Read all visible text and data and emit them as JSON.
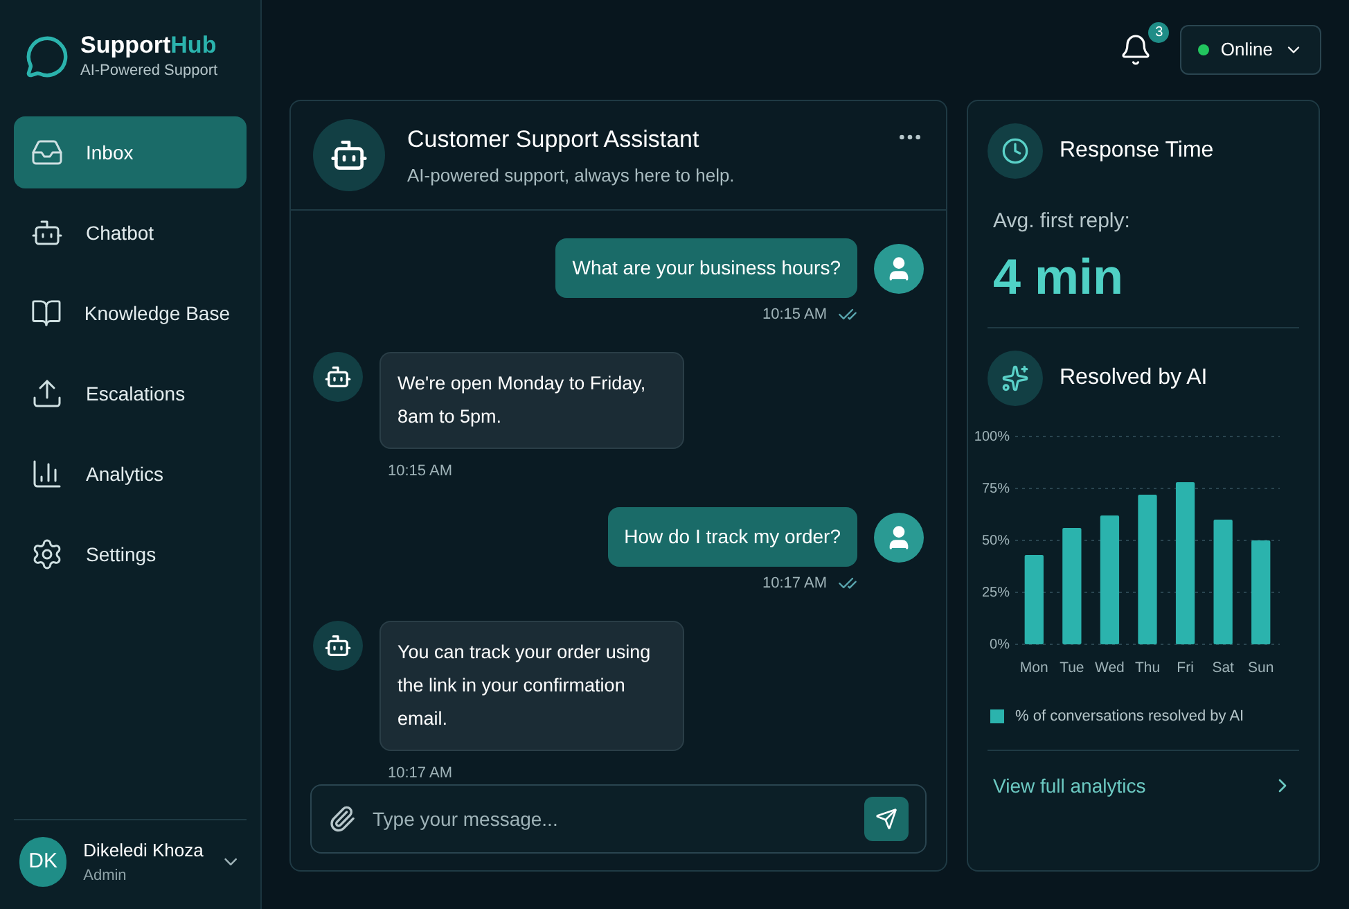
{
  "brand": {
    "name": "Support",
    "name_accent": "Hub",
    "tagline": "AI-Powered Support"
  },
  "nav": [
    {
      "label": "Inbox",
      "selected": true
    },
    {
      "label": "Chatbot",
      "selected": false
    },
    {
      "label": "Knowledge Base",
      "selected": false
    },
    {
      "label": "Escalations",
      "selected": false
    },
    {
      "label": "Analytics",
      "selected": false
    },
    {
      "label": "Settings",
      "selected": false
    }
  ],
  "user": {
    "initials": "DK",
    "name": "Dikeledi Khoza",
    "role": "Admin"
  },
  "topbar": {
    "notifications": "3",
    "status": {
      "label": "Online",
      "color": "#22c55e"
    }
  },
  "chat": {
    "title": "Customer Support Assistant",
    "subtitle": "AI-powered support, always here to help.",
    "messages": [
      {
        "kind": "user",
        "text": "What are your business hours?",
        "time": "10:15 AM"
      },
      {
        "kind": "bot",
        "text": "We're open Monday to Friday, 8am to 5pm.",
        "time": "10:15 AM"
      },
      {
        "kind": "user",
        "text": "How do I track my order?",
        "time": "10:17 AM"
      },
      {
        "kind": "bot",
        "text": "You can track your order using the link in your confirmation email.",
        "time": "10:17 AM"
      }
    ],
    "input": {
      "placeholder": "Type your message..."
    }
  },
  "response_time": {
    "title": "Response Time",
    "label": "Avg. first reply:",
    "value": "4 min"
  },
  "resolved": {
    "title": "Resolved by AI",
    "link": "View full analytics",
    "chart_data": {
      "type": "bar",
      "categories": [
        "Mon",
        "Tue",
        "Wed",
        "Thu",
        "Fri",
        "Sat",
        "Sun"
      ],
      "series": [
        {
          "name": "% of conversations resolved by AI",
          "color": "#2bb3ad",
          "values": [
            43,
            56,
            62,
            72,
            78,
            60,
            50
          ]
        }
      ],
      "ylim": [
        0,
        100
      ],
      "grid": true,
      "yticks": [
        {
          "value": 0,
          "label": "0%"
        },
        {
          "value": 25,
          "label": "25%"
        },
        {
          "value": 50,
          "label": "50%"
        },
        {
          "value": 75,
          "label": "75%"
        },
        {
          "value": 100,
          "label": "100%"
        }
      ]
    }
  }
}
